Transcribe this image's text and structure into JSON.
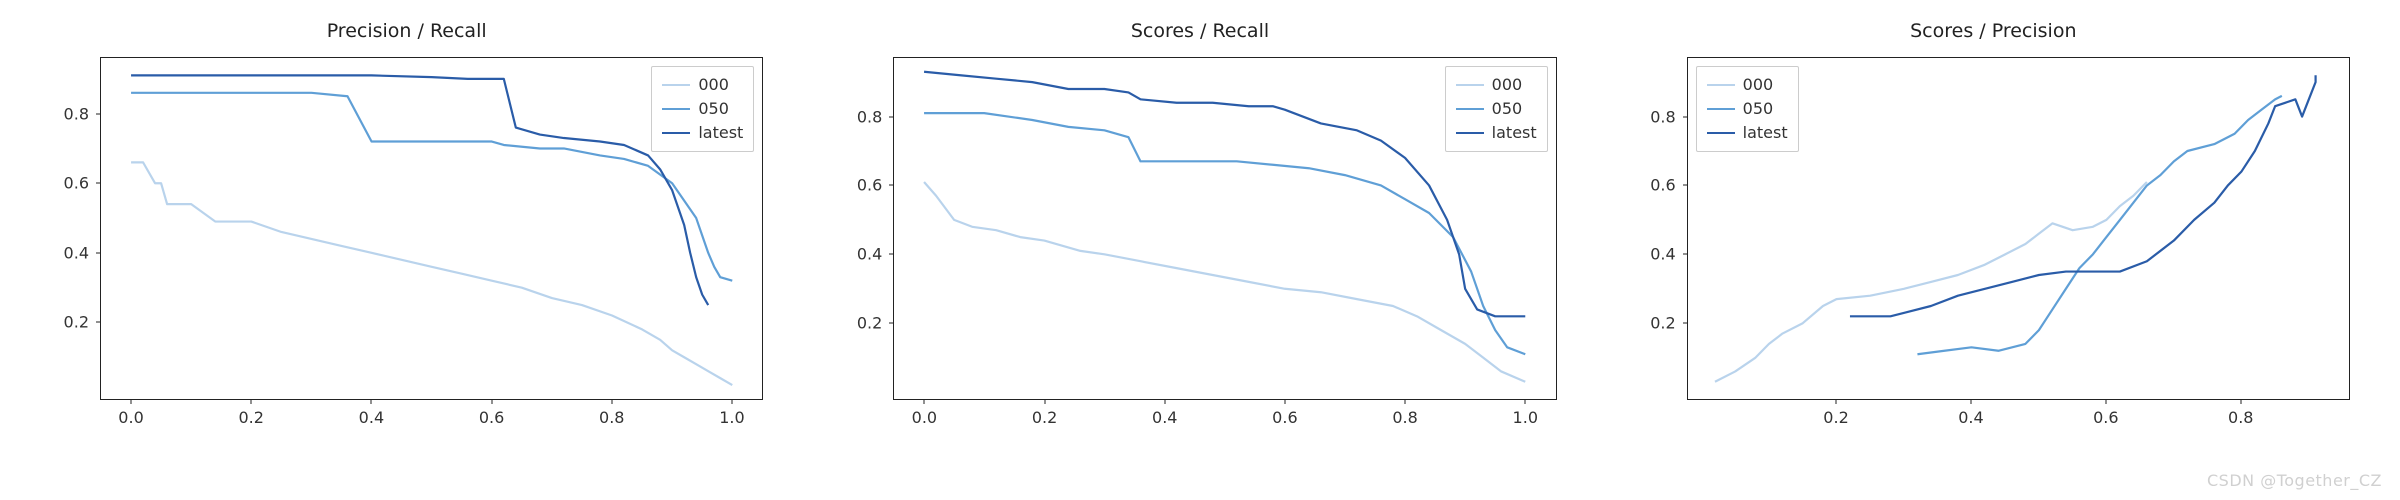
{
  "colors": {
    "s000": "#b9d3ec",
    "s050": "#5f9fd6",
    "slatest": "#2a5ca8"
  },
  "watermark": "CSDN @Together_CZ",
  "chart_data": [
    {
      "type": "line",
      "title": "Precision / Recall",
      "xlabel": "",
      "ylabel": "",
      "xticks": [
        0.0,
        0.2,
        0.4,
        0.6,
        0.8,
        1.0
      ],
      "yticks": [
        0.2,
        0.4,
        0.6,
        0.8
      ],
      "xlim": [
        -0.05,
        1.05
      ],
      "ylim": [
        -0.02,
        0.96
      ],
      "legend_pos": "right",
      "series": [
        {
          "name": "000",
          "color_key": "s000",
          "data": [
            [
              0.0,
              0.66
            ],
            [
              0.02,
              0.66
            ],
            [
              0.04,
              0.6
            ],
            [
              0.05,
              0.6
            ],
            [
              0.06,
              0.54
            ],
            [
              0.1,
              0.54
            ],
            [
              0.14,
              0.49
            ],
            [
              0.2,
              0.49
            ],
            [
              0.25,
              0.46
            ],
            [
              0.3,
              0.44
            ],
            [
              0.35,
              0.42
            ],
            [
              0.4,
              0.4
            ],
            [
              0.45,
              0.38
            ],
            [
              0.5,
              0.36
            ],
            [
              0.55,
              0.34
            ],
            [
              0.6,
              0.32
            ],
            [
              0.65,
              0.3
            ],
            [
              0.7,
              0.27
            ],
            [
              0.75,
              0.25
            ],
            [
              0.8,
              0.22
            ],
            [
              0.85,
              0.18
            ],
            [
              0.88,
              0.15
            ],
            [
              0.9,
              0.12
            ],
            [
              0.92,
              0.1
            ],
            [
              0.94,
              0.08
            ],
            [
              0.96,
              0.06
            ],
            [
              0.98,
              0.04
            ],
            [
              1.0,
              0.02
            ]
          ]
        },
        {
          "name": "050",
          "color_key": "s050",
          "data": [
            [
              0.0,
              0.86
            ],
            [
              0.1,
              0.86
            ],
            [
              0.2,
              0.86
            ],
            [
              0.3,
              0.86
            ],
            [
              0.36,
              0.85
            ],
            [
              0.4,
              0.72
            ],
            [
              0.5,
              0.72
            ],
            [
              0.6,
              0.72
            ],
            [
              0.62,
              0.71
            ],
            [
              0.68,
              0.7
            ],
            [
              0.72,
              0.7
            ],
            [
              0.78,
              0.68
            ],
            [
              0.82,
              0.67
            ],
            [
              0.86,
              0.65
            ],
            [
              0.9,
              0.6
            ],
            [
              0.92,
              0.55
            ],
            [
              0.94,
              0.5
            ],
            [
              0.95,
              0.45
            ],
            [
              0.96,
              0.4
            ],
            [
              0.97,
              0.36
            ],
            [
              0.98,
              0.33
            ],
            [
              1.0,
              0.32
            ]
          ]
        },
        {
          "name": "latest",
          "color_key": "slatest",
          "data": [
            [
              0.0,
              0.91
            ],
            [
              0.1,
              0.91
            ],
            [
              0.2,
              0.91
            ],
            [
              0.3,
              0.91
            ],
            [
              0.4,
              0.91
            ],
            [
              0.5,
              0.905
            ],
            [
              0.56,
              0.9
            ],
            [
              0.6,
              0.9
            ],
            [
              0.62,
              0.9
            ],
            [
              0.64,
              0.76
            ],
            [
              0.68,
              0.74
            ],
            [
              0.72,
              0.73
            ],
            [
              0.78,
              0.72
            ],
            [
              0.82,
              0.71
            ],
            [
              0.86,
              0.68
            ],
            [
              0.88,
              0.64
            ],
            [
              0.9,
              0.58
            ],
            [
              0.92,
              0.48
            ],
            [
              0.93,
              0.4
            ],
            [
              0.94,
              0.33
            ],
            [
              0.95,
              0.28
            ],
            [
              0.96,
              0.25
            ]
          ]
        }
      ]
    },
    {
      "type": "line",
      "title": "Scores / Recall",
      "xlabel": "",
      "ylabel": "",
      "xticks": [
        0.0,
        0.2,
        0.4,
        0.6,
        0.8,
        1.0
      ],
      "yticks": [
        0.2,
        0.4,
        0.6,
        0.8
      ],
      "xlim": [
        -0.05,
        1.05
      ],
      "ylim": [
        -0.02,
        0.97
      ],
      "legend_pos": "right",
      "series": [
        {
          "name": "000",
          "color_key": "s000",
          "data": [
            [
              0.0,
              0.61
            ],
            [
              0.02,
              0.57
            ],
            [
              0.05,
              0.5
            ],
            [
              0.08,
              0.48
            ],
            [
              0.12,
              0.47
            ],
            [
              0.16,
              0.45
            ],
            [
              0.2,
              0.44
            ],
            [
              0.26,
              0.41
            ],
            [
              0.3,
              0.4
            ],
            [
              0.36,
              0.38
            ],
            [
              0.42,
              0.36
            ],
            [
              0.48,
              0.34
            ],
            [
              0.54,
              0.32
            ],
            [
              0.6,
              0.3
            ],
            [
              0.66,
              0.29
            ],
            [
              0.72,
              0.27
            ],
            [
              0.78,
              0.25
            ],
            [
              0.82,
              0.22
            ],
            [
              0.86,
              0.18
            ],
            [
              0.9,
              0.14
            ],
            [
              0.93,
              0.1
            ],
            [
              0.96,
              0.06
            ],
            [
              1.0,
              0.03
            ]
          ]
        },
        {
          "name": "050",
          "color_key": "s050",
          "data": [
            [
              0.0,
              0.81
            ],
            [
              0.1,
              0.81
            ],
            [
              0.18,
              0.79
            ],
            [
              0.24,
              0.77
            ],
            [
              0.3,
              0.76
            ],
            [
              0.34,
              0.74
            ],
            [
              0.36,
              0.67
            ],
            [
              0.44,
              0.67
            ],
            [
              0.52,
              0.67
            ],
            [
              0.58,
              0.66
            ],
            [
              0.64,
              0.65
            ],
            [
              0.7,
              0.63
            ],
            [
              0.76,
              0.6
            ],
            [
              0.8,
              0.56
            ],
            [
              0.84,
              0.52
            ],
            [
              0.88,
              0.45
            ],
            [
              0.91,
              0.35
            ],
            [
              0.93,
              0.25
            ],
            [
              0.95,
              0.18
            ],
            [
              0.97,
              0.13
            ],
            [
              1.0,
              0.11
            ]
          ]
        },
        {
          "name": "latest",
          "color_key": "slatest",
          "data": [
            [
              0.0,
              0.93
            ],
            [
              0.06,
              0.92
            ],
            [
              0.12,
              0.91
            ],
            [
              0.18,
              0.9
            ],
            [
              0.24,
              0.88
            ],
            [
              0.3,
              0.88
            ],
            [
              0.34,
              0.87
            ],
            [
              0.36,
              0.85
            ],
            [
              0.42,
              0.84
            ],
            [
              0.48,
              0.84
            ],
            [
              0.54,
              0.83
            ],
            [
              0.58,
              0.83
            ],
            [
              0.6,
              0.82
            ],
            [
              0.66,
              0.78
            ],
            [
              0.72,
              0.76
            ],
            [
              0.76,
              0.73
            ],
            [
              0.8,
              0.68
            ],
            [
              0.84,
              0.6
            ],
            [
              0.87,
              0.5
            ],
            [
              0.89,
              0.4
            ],
            [
              0.9,
              0.3
            ],
            [
              0.92,
              0.24
            ],
            [
              0.95,
              0.22
            ],
            [
              1.0,
              0.22
            ]
          ]
        }
      ]
    },
    {
      "type": "line",
      "title": "Scores / Precision",
      "xlabel": "",
      "ylabel": "",
      "xticks": [
        0.2,
        0.4,
        0.6,
        0.8
      ],
      "yticks": [
        0.2,
        0.4,
        0.6,
        0.8
      ],
      "xlim": [
        -0.02,
        0.96
      ],
      "ylim": [
        -0.02,
        0.97
      ],
      "legend_pos": "left",
      "series": [
        {
          "name": "000",
          "color_key": "s000",
          "data": [
            [
              0.02,
              0.03
            ],
            [
              0.05,
              0.06
            ],
            [
              0.08,
              0.1
            ],
            [
              0.1,
              0.14
            ],
            [
              0.12,
              0.17
            ],
            [
              0.15,
              0.2
            ],
            [
              0.18,
              0.25
            ],
            [
              0.2,
              0.27
            ],
            [
              0.25,
              0.28
            ],
            [
              0.3,
              0.3
            ],
            [
              0.34,
              0.32
            ],
            [
              0.38,
              0.34
            ],
            [
              0.42,
              0.37
            ],
            [
              0.45,
              0.4
            ],
            [
              0.48,
              0.43
            ],
            [
              0.5,
              0.46
            ],
            [
              0.52,
              0.49
            ],
            [
              0.55,
              0.47
            ],
            [
              0.58,
              0.48
            ],
            [
              0.6,
              0.5
            ],
            [
              0.62,
              0.54
            ],
            [
              0.64,
              0.57
            ],
            [
              0.66,
              0.61
            ]
          ]
        },
        {
          "name": "050",
          "color_key": "s050",
          "data": [
            [
              0.32,
              0.11
            ],
            [
              0.36,
              0.12
            ],
            [
              0.4,
              0.13
            ],
            [
              0.44,
              0.12
            ],
            [
              0.48,
              0.14
            ],
            [
              0.5,
              0.18
            ],
            [
              0.52,
              0.24
            ],
            [
              0.54,
              0.3
            ],
            [
              0.56,
              0.36
            ],
            [
              0.58,
              0.4
            ],
            [
              0.6,
              0.45
            ],
            [
              0.62,
              0.5
            ],
            [
              0.64,
              0.55
            ],
            [
              0.66,
              0.6
            ],
            [
              0.68,
              0.63
            ],
            [
              0.7,
              0.67
            ],
            [
              0.72,
              0.7
            ],
            [
              0.76,
              0.72
            ],
            [
              0.79,
              0.75
            ],
            [
              0.81,
              0.79
            ],
            [
              0.83,
              0.82
            ],
            [
              0.85,
              0.85
            ],
            [
              0.86,
              0.86
            ]
          ]
        },
        {
          "name": "latest",
          "color_key": "slatest",
          "data": [
            [
              0.22,
              0.22
            ],
            [
              0.28,
              0.22
            ],
            [
              0.34,
              0.25
            ],
            [
              0.38,
              0.28
            ],
            [
              0.42,
              0.3
            ],
            [
              0.46,
              0.32
            ],
            [
              0.5,
              0.34
            ],
            [
              0.54,
              0.35
            ],
            [
              0.58,
              0.35
            ],
            [
              0.62,
              0.35
            ],
            [
              0.66,
              0.38
            ],
            [
              0.7,
              0.44
            ],
            [
              0.73,
              0.5
            ],
            [
              0.76,
              0.55
            ],
            [
              0.78,
              0.6
            ],
            [
              0.8,
              0.64
            ],
            [
              0.82,
              0.7
            ],
            [
              0.84,
              0.78
            ],
            [
              0.85,
              0.83
            ],
            [
              0.88,
              0.85
            ],
            [
              0.89,
              0.8
            ],
            [
              0.9,
              0.85
            ],
            [
              0.91,
              0.9
            ],
            [
              0.91,
              0.92
            ]
          ]
        }
      ]
    }
  ]
}
